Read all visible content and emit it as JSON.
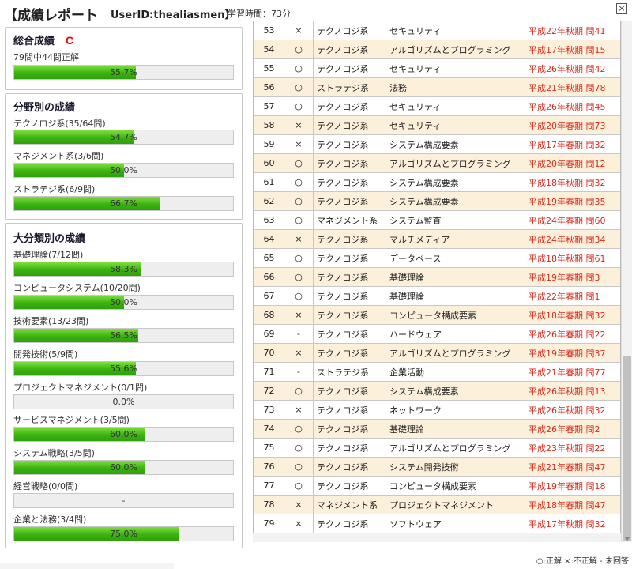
{
  "header": {
    "title": "【成績レポート",
    "userid": "UserID:thealiasmen】",
    "study_time": "学習時間：73分",
    "close_label": "×"
  },
  "total": {
    "heading": "総合成績",
    "grade": "C",
    "summary": "79問中44問正解",
    "percent": 55.7,
    "percent_text": "55.7%"
  },
  "fields": {
    "heading": "分野別の成績",
    "items": [
      {
        "label": "テクノロジ系(35/64問)",
        "percent": 54.7,
        "percent_text": "54.7%"
      },
      {
        "label": "マネジメント系(3/6問)",
        "percent": 50.0,
        "percent_text": "50.0%"
      },
      {
        "label": "ストラテジ系(6/9問)",
        "percent": 66.7,
        "percent_text": "66.7%"
      }
    ]
  },
  "categories": {
    "heading": "大分類別の成績",
    "items": [
      {
        "label": "基礎理論(7/12問)",
        "percent": 58.3,
        "percent_text": "58.3%"
      },
      {
        "label": "コンピュータシステム(10/20問)",
        "percent": 50.0,
        "percent_text": "50.0%"
      },
      {
        "label": "技術要素(13/23問)",
        "percent": 56.5,
        "percent_text": "56.5%"
      },
      {
        "label": "開発技術(5/9問)",
        "percent": 55.6,
        "percent_text": "55.6%"
      },
      {
        "label": "プロジェクトマネジメント(0/1問)",
        "percent": 0,
        "percent_text": "0.0%"
      },
      {
        "label": "サービスマネジメント(3/5問)",
        "percent": 60.0,
        "percent_text": "60.0%"
      },
      {
        "label": "システム戦略(3/5問)",
        "percent": 60.0,
        "percent_text": "60.0%"
      },
      {
        "label": "経営戦略(0/0問)",
        "percent": 0,
        "percent_text": "-"
      },
      {
        "label": "企業と法務(3/4問)",
        "percent": 75.0,
        "percent_text": "75.0%"
      }
    ]
  },
  "rows": [
    {
      "no": "53",
      "mark": "×",
      "field": "テクノロジ系",
      "category": "セキュリティ",
      "source": "平成22年秋期 問41"
    },
    {
      "no": "54",
      "mark": "○",
      "field": "テクノロジ系",
      "category": "アルゴリズムとプログラミング",
      "source": "平成17年秋期 問15"
    },
    {
      "no": "55",
      "mark": "○",
      "field": "テクノロジ系",
      "category": "セキュリティ",
      "source": "平成26年秋期 問42"
    },
    {
      "no": "56",
      "mark": "○",
      "field": "ストラテジ系",
      "category": "法務",
      "source": "平成21年秋期 問78"
    },
    {
      "no": "57",
      "mark": "○",
      "field": "テクノロジ系",
      "category": "セキュリティ",
      "source": "平成26年秋期 問45"
    },
    {
      "no": "58",
      "mark": "×",
      "field": "テクノロジ系",
      "category": "セキュリティ",
      "source": "平成20年春期 問73"
    },
    {
      "no": "59",
      "mark": "×",
      "field": "テクノロジ系",
      "category": "システム構成要素",
      "source": "平成17年春期 問32"
    },
    {
      "no": "60",
      "mark": "○",
      "field": "テクノロジ系",
      "category": "アルゴリズムとプログラミング",
      "source": "平成20年春期 問12"
    },
    {
      "no": "61",
      "mark": "○",
      "field": "テクノロジ系",
      "category": "システム構成要素",
      "source": "平成18年秋期 問32"
    },
    {
      "no": "62",
      "mark": "○",
      "field": "テクノロジ系",
      "category": "システム構成要素",
      "source": "平成19年春期 問35"
    },
    {
      "no": "63",
      "mark": "○",
      "field": "マネジメント系",
      "category": "システム監査",
      "source": "平成24年春期 問60"
    },
    {
      "no": "64",
      "mark": "×",
      "field": "テクノロジ系",
      "category": "マルチメディア",
      "source": "平成24年秋期 問34"
    },
    {
      "no": "65",
      "mark": "○",
      "field": "テクノロジ系",
      "category": "データベース",
      "source": "平成18年秋期 問61"
    },
    {
      "no": "66",
      "mark": "○",
      "field": "テクノロジ系",
      "category": "基礎理論",
      "source": "平成19年春期 問3"
    },
    {
      "no": "67",
      "mark": "○",
      "field": "テクノロジ系",
      "category": "基礎理論",
      "source": "平成22年春期 問1"
    },
    {
      "no": "68",
      "mark": "×",
      "field": "テクノロジ系",
      "category": "コンピュータ構成要素",
      "source": "平成18年春期 問32"
    },
    {
      "no": "69",
      "mark": "-",
      "field": "テクノロジ系",
      "category": "ハードウェア",
      "source": "平成26年春期 問22"
    },
    {
      "no": "70",
      "mark": "×",
      "field": "テクノロジ系",
      "category": "アルゴリズムとプログラミング",
      "source": "平成19年春期 問37"
    },
    {
      "no": "71",
      "mark": "-",
      "field": "ストラテジ系",
      "category": "企業活動",
      "source": "平成21年春期 問77"
    },
    {
      "no": "72",
      "mark": "○",
      "field": "テクノロジ系",
      "category": "システム構成要素",
      "source": "平成26年秋期 問13"
    },
    {
      "no": "73",
      "mark": "×",
      "field": "テクノロジ系",
      "category": "ネットワーク",
      "source": "平成26年秋期 問32"
    },
    {
      "no": "74",
      "mark": "○",
      "field": "テクノロジ系",
      "category": "基礎理論",
      "source": "平成26年春期 問2"
    },
    {
      "no": "75",
      "mark": "○",
      "field": "テクノロジ系",
      "category": "アルゴリズムとプログラミング",
      "source": "平成23年秋期 問22"
    },
    {
      "no": "76",
      "mark": "○",
      "field": "テクノロジ系",
      "category": "システム開発技術",
      "source": "平成21年春期 問47"
    },
    {
      "no": "77",
      "mark": "○",
      "field": "テクノロジ系",
      "category": "コンピュータ構成要素",
      "source": "平成19年春期 問18"
    },
    {
      "no": "78",
      "mark": "×",
      "field": "マネジメント系",
      "category": "プロジェクトマネジメント",
      "source": "平成18年春期 問47"
    },
    {
      "no": "79",
      "mark": "×",
      "field": "テクノロジ系",
      "category": "ソフトウェア",
      "source": "平成17年秋期 問32"
    }
  ],
  "legend": "○:正解 ×:不正解 -:未回答",
  "colors": {
    "bar_fill": "#3bb312",
    "row_alt": "#fdf0da",
    "source_text": "#d62b1e",
    "grade": "#e00000"
  }
}
